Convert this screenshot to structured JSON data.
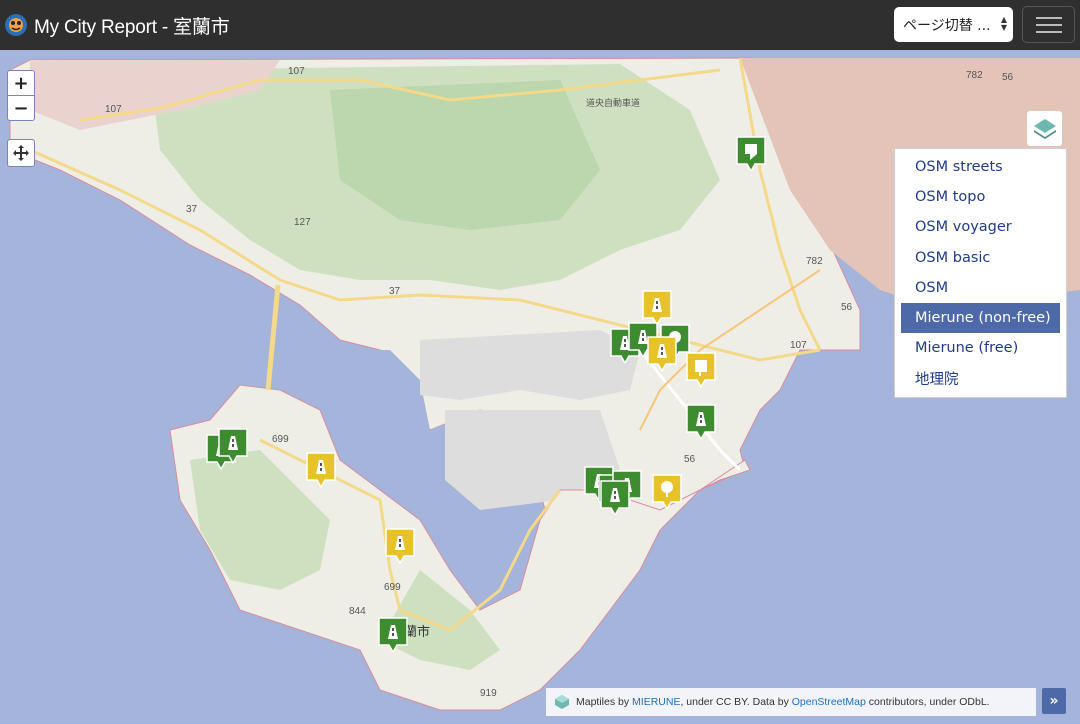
{
  "navbar": {
    "title": "My City Report - 室蘭市",
    "page_switch": "ページ切替 ...",
    "page_switch_arrows": "▲\n▼"
  },
  "map_controls": {
    "zoom_in": "+",
    "zoom_out": "−"
  },
  "layers": {
    "items": [
      "OSM streets",
      "OSM topo",
      "OSM voyager",
      "OSM basic",
      "OSM",
      "Mierune (non-free)",
      "Mierune (free)",
      "地理院"
    ],
    "active": "Mierune (non-free)"
  },
  "attribution": {
    "prefix": "Maptiles by ",
    "mierune": "MIERUNE",
    "middle": ", under CC BY. Data by ",
    "osm": "OpenStreetMap",
    "suffix": " contributors, under ODbL.",
    "expand": "»"
  },
  "map_labels": {
    "route_107a": "107",
    "route_107b": "107",
    "route_107c": "107",
    "route_127": "127",
    "route_37a": "37",
    "route_37b": "37",
    "route_699a": "699",
    "route_699b": "699",
    "route_844": "844",
    "route_919": "919",
    "route_782a": "782",
    "route_782b": "782",
    "route_56a": "56",
    "route_56b": "56",
    "route_56c": "56",
    "city_label": "蘭市",
    "expressway": "道央自動車道"
  },
  "colors": {
    "navbar": "#2f2f2f",
    "sea": "#a5b4da",
    "land": "#eeeee7",
    "forest": "#cfe0c0",
    "marker_green": "#3d8c2f",
    "marker_yellow": "#e8c22a",
    "active_layer": "#4d69a8"
  },
  "markers": [
    {
      "type": "green",
      "icon": "flag-icon"
    },
    {
      "type": "yellow",
      "icon": "road-icon"
    },
    {
      "type": "green",
      "icon": "road-icon"
    },
    {
      "type": "green",
      "icon": "road-icon"
    },
    {
      "type": "green",
      "icon": "tree-icon"
    },
    {
      "type": "yellow",
      "icon": "road-icon"
    },
    {
      "type": "yellow",
      "icon": "sign-icon"
    },
    {
      "type": "green",
      "icon": "road-icon"
    },
    {
      "type": "green",
      "icon": "road-icon"
    },
    {
      "type": "green",
      "icon": "road-icon"
    },
    {
      "type": "yellow",
      "icon": "road-icon"
    },
    {
      "type": "yellow",
      "icon": "road-icon"
    },
    {
      "type": "green",
      "icon": "road-icon"
    },
    {
      "type": "green",
      "icon": "road-icon"
    },
    {
      "type": "green",
      "icon": "road-icon"
    },
    {
      "type": "green",
      "icon": "road-icon"
    },
    {
      "type": "yellow",
      "icon": "tree-icon"
    },
    {
      "type": "green",
      "icon": "road-icon"
    }
  ]
}
